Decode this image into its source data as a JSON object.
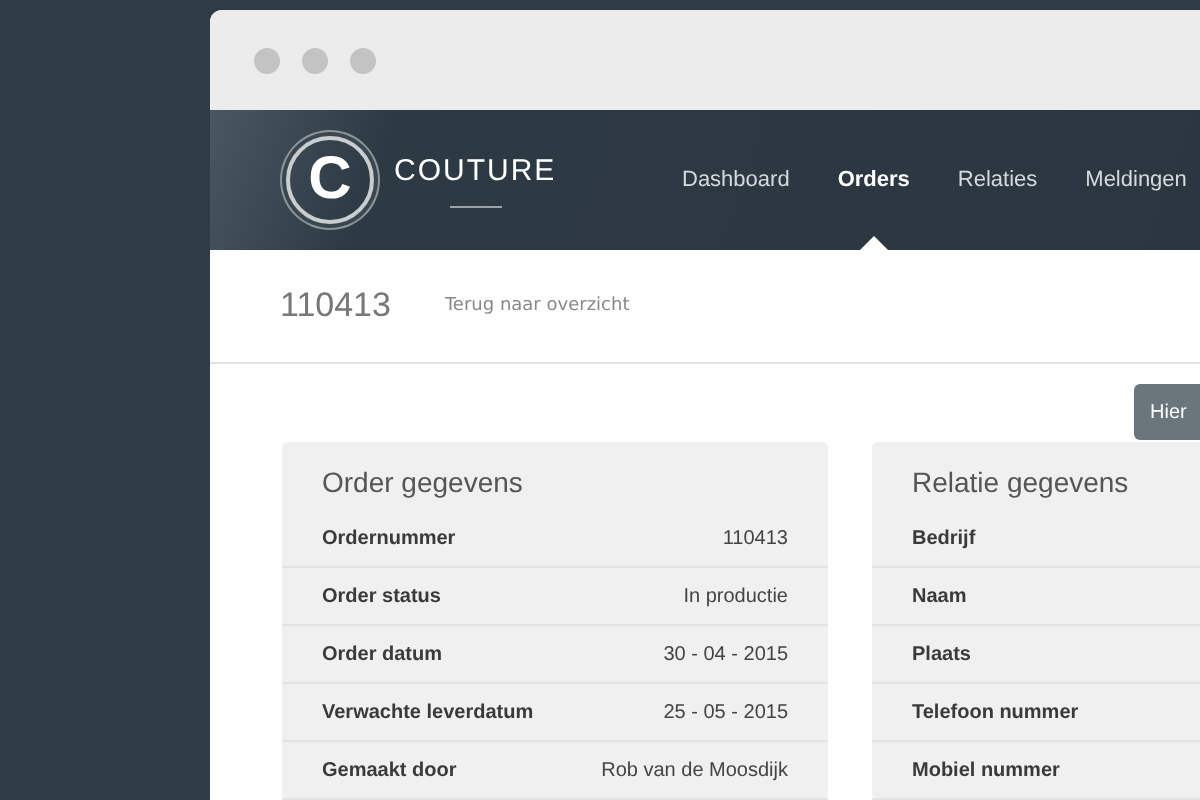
{
  "logo": {
    "letter": "C",
    "name": "COUTURE"
  },
  "nav": [
    {
      "label": "Dashboard",
      "selected": false
    },
    {
      "label": "Orders",
      "selected": true
    },
    {
      "label": "Relaties",
      "selected": false
    },
    {
      "label": "Meldingen",
      "selected": false
    }
  ],
  "header": {
    "order_number": "110413",
    "back_link": "Terug naar overzicht"
  },
  "action_button": "Hier",
  "cards": [
    {
      "title": "Order gegevens",
      "rows": [
        {
          "label": "Ordernummer",
          "value": "110413"
        },
        {
          "label": "Order status",
          "value": "In productie"
        },
        {
          "label": "Order datum",
          "value": "30 - 04 - 2015"
        },
        {
          "label": "Verwachte leverdatum",
          "value": "25 - 05 - 2015"
        },
        {
          "label": "Gemaakt door",
          "value": "Rob van de Moosdijk"
        }
      ]
    },
    {
      "title": "Relatie gegevens",
      "rows": [
        {
          "label": "Bedrijf"
        },
        {
          "label": "Naam"
        },
        {
          "label": "Plaats"
        },
        {
          "label": "Telefoon nummer"
        },
        {
          "label": "Mobiel nummer"
        }
      ]
    }
  ]
}
